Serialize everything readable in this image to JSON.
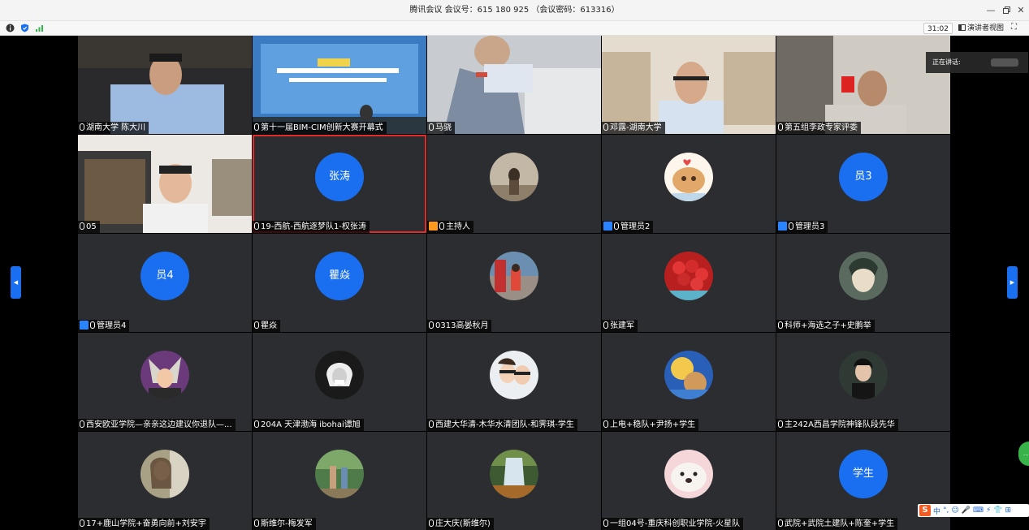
{
  "window": {
    "title": "腾讯会议 会议号：615 180 925  （会议密码：613316）",
    "minimize": "—",
    "restore": "ⅽ",
    "close": "✕"
  },
  "toolbar": {
    "timer": "31:02",
    "speaker_view_label": "演讲者视图",
    "fullscreen": "⛶"
  },
  "speaking": {
    "label": "正在讲话:"
  },
  "green_bubble": {
    "label": "..."
  },
  "nav": {
    "prev": "◀",
    "next": "▶"
  },
  "tiles": [
    {
      "name": "湖南大学 陈大川"
    },
    {
      "name": "第十一届BIM-CIM创新大赛开幕式"
    },
    {
      "name": "马骁"
    },
    {
      "name": "邓露-湖南大学"
    },
    {
      "name": "第五组李政专家评委"
    },
    {
      "name": "05"
    },
    {
      "name": "19-西航-西航逐梦队1-权张涛",
      "avatar_text": "张涛"
    },
    {
      "name": "主持人"
    },
    {
      "name": "管理员2"
    },
    {
      "name": "管理员3",
      "avatar_text": "员3"
    },
    {
      "name": "管理员4",
      "avatar_text": "员4"
    },
    {
      "name": "瞿焱",
      "avatar_text": "瞿焱"
    },
    {
      "name": "0313高晏秋月"
    },
    {
      "name": "张建军"
    },
    {
      "name": "科师+海选之子+史鹏举"
    },
    {
      "name": "西安欧亚学院—亲亲这边建议你退队—..."
    },
    {
      "name": "204A  天津渤海  ibohai谭旭"
    },
    {
      "name": "西建大华清-木华水清团队-和霁琪-学生"
    },
    {
      "name": "上电+稳队+尹扬+学生"
    },
    {
      "name": "主242A西昌学院神锋队段先华"
    },
    {
      "name": "17+鹿山学院+奋勇向前+刘安宇"
    },
    {
      "name": "斯维尔-梅发军"
    },
    {
      "name": "庄大庆(斯维尔)"
    },
    {
      "name": "一组04号-重庆科创职业学院-火星队"
    },
    {
      "name": "武院+武院土建队+陈奎+学生",
      "avatar_text": "学生"
    }
  ],
  "ime": {
    "chars": [
      "中",
      "°,",
      "☺",
      "🎤",
      "⌨",
      "⚡",
      "👕",
      "⊞"
    ]
  },
  "colors": {
    "accent": "#1a6ff0",
    "active_border": "#e52a2a",
    "tile_bg": "#2b2d30"
  }
}
